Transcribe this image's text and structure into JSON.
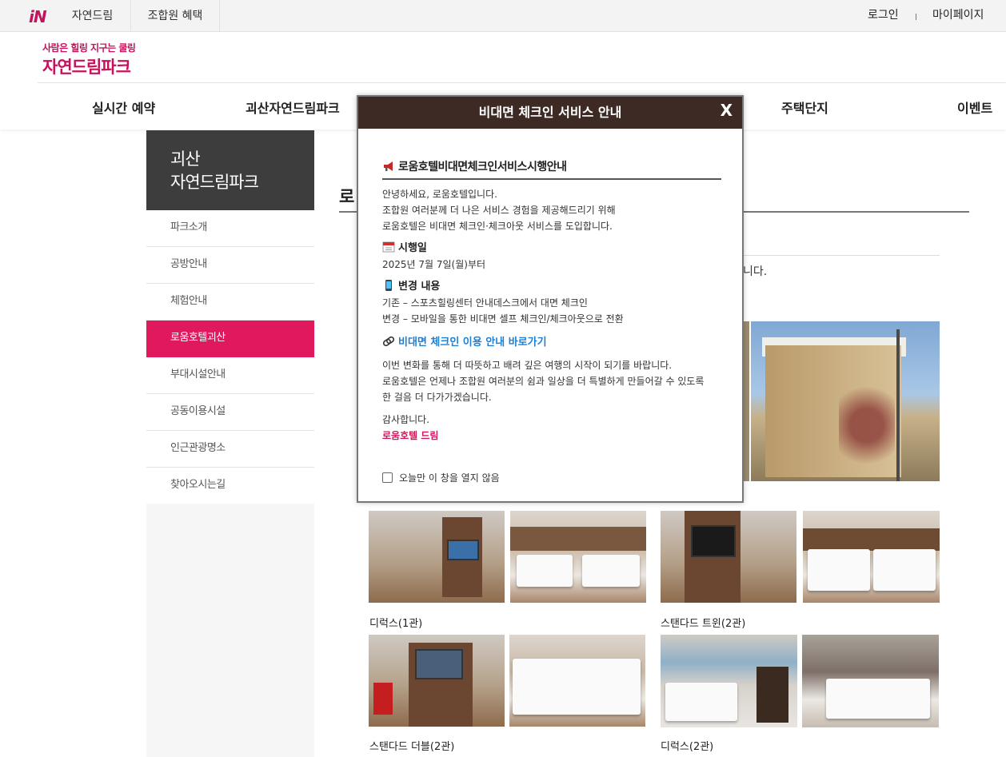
{
  "topbar": {
    "logo": "iN",
    "tabs": [
      "자연드림",
      "조합원 혜택"
    ],
    "login": "로그인",
    "mypage": "마이페이지"
  },
  "brand": {
    "slogan": "사람은 힐링 지구는 쿨링",
    "name": "자연드림파크"
  },
  "mainnav": [
    "실시간 예약",
    "괴산자연드림파크",
    "주택단지",
    "이벤트"
  ],
  "sidebar": {
    "title_line1": "괴산",
    "title_line2": "자연드림파크",
    "items": [
      "파크소개",
      "공방안내",
      "체험안내",
      "로움호텔괴산",
      "부대시설안내",
      "공동이용시설",
      "인근관광명소",
      "찾아오시는길"
    ],
    "active": "로움호텔괴산"
  },
  "content": {
    "title_frag": "로",
    "text_frag": "니다.",
    "captions": [
      "디럭스(1관)",
      "스탠다드 트윈(2관)",
      "스탠다드 더블(2관)",
      "디럭스(2관)"
    ]
  },
  "modal": {
    "header": "비대면 체크인 서비스 안내",
    "close": "X",
    "title": "로움호텔비대면체크인서비스시행안내",
    "greeting": [
      "안녕하세요, 로움호텔입니다.",
      "조합원 여러분께 더 나은 서비스 경험을 제공해드리기 위해",
      "로움호텔은 비대면 체크인·체크아웃 서비스를 도입합니다."
    ],
    "date_heading": "시행일",
    "date_text": "2025년 7월 7일(월)부터",
    "change_heading": "변경 내용",
    "change_before": "기존 – 스포츠힐링센터 안내데스크에서 대면 체크인",
    "change_after": "변경 – 모바일을 통한 비대면 셀프 체크인/체크아웃으로 전환",
    "link": "비대면 체크인 이용 안내 바로가기",
    "closing": [
      "이번 변화를 통해 더 따뜻하고 배려 깊은 여행의 시작이 되기를 바랍니다.",
      "로움호텔은 언제나 조합원 여러분의 쉼과 일상을 더 특별하게 만들어갈 수 있도록",
      "한 걸음 더 다가가겠습니다."
    ],
    "thanks": "감사합니다.",
    "sign": "로움호텔 드림",
    "checkbox_label": "오늘만 이 창을 열지 않음"
  },
  "colors": {
    "brand": "#c4125c",
    "active": "#e0185e",
    "modal_head": "#3e2a24",
    "link": "#1c7fd6"
  }
}
